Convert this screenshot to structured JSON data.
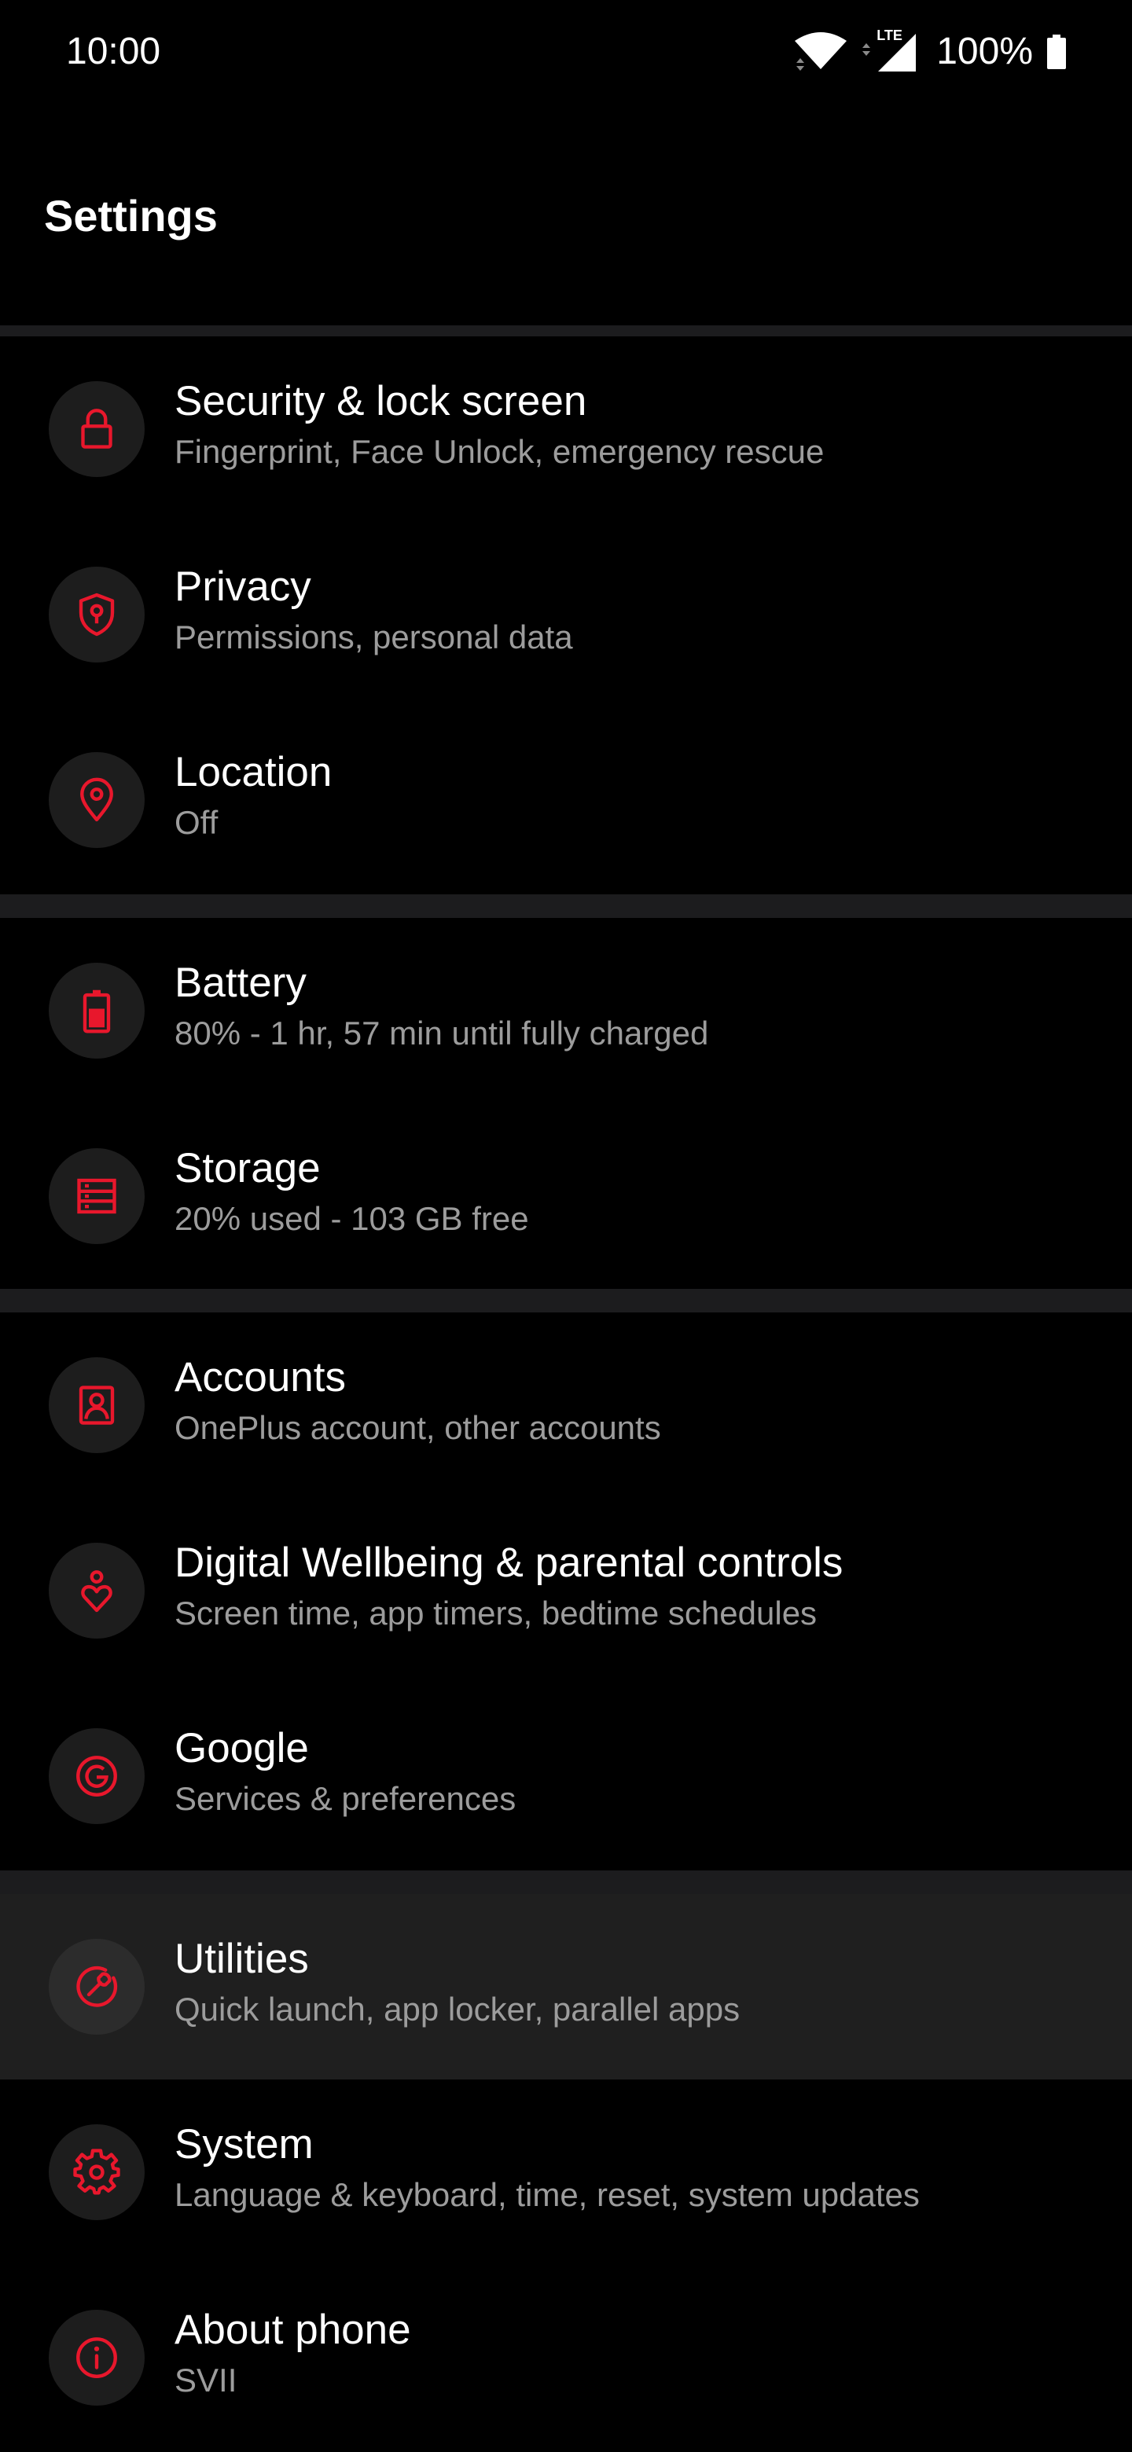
{
  "status_bar": {
    "time": "10:00",
    "network_label": "LTE",
    "battery_percent": "100%",
    "icons": [
      "wifi-icon",
      "signal-icon",
      "battery-icon"
    ]
  },
  "header": {
    "title": "Settings"
  },
  "accent_color": "#e8172c",
  "items": [
    {
      "title": "Security & lock screen",
      "subtitle": "Fingerprint, Face Unlock, emergency rescue",
      "icon": "lock-icon"
    },
    {
      "title": "Privacy",
      "subtitle": "Permissions, personal data",
      "icon": "privacy-shield-icon"
    },
    {
      "title": "Location",
      "subtitle": "Off",
      "icon": "location-pin-icon"
    },
    {
      "title": "Battery",
      "subtitle": "80% - 1 hr, 57 min until fully charged",
      "icon": "battery-icon"
    },
    {
      "title": "Storage",
      "subtitle": "20% used - 103 GB free",
      "icon": "storage-icon"
    },
    {
      "title": "Accounts",
      "subtitle": "OnePlus account, other accounts",
      "icon": "account-icon"
    },
    {
      "title": "Digital Wellbeing & parental controls",
      "subtitle": "Screen time, app timers, bedtime schedules",
      "icon": "wellbeing-icon"
    },
    {
      "title": "Google",
      "subtitle": "Services & preferences",
      "icon": "google-icon"
    },
    {
      "title": "Utilities",
      "subtitle": "Quick launch, app locker, parallel apps",
      "icon": "utilities-icon"
    },
    {
      "title": "System",
      "subtitle": "Language & keyboard, time, reset, system updates",
      "icon": "gear-icon"
    },
    {
      "title": "About phone",
      "subtitle": "SVII",
      "icon": "info-icon"
    }
  ]
}
